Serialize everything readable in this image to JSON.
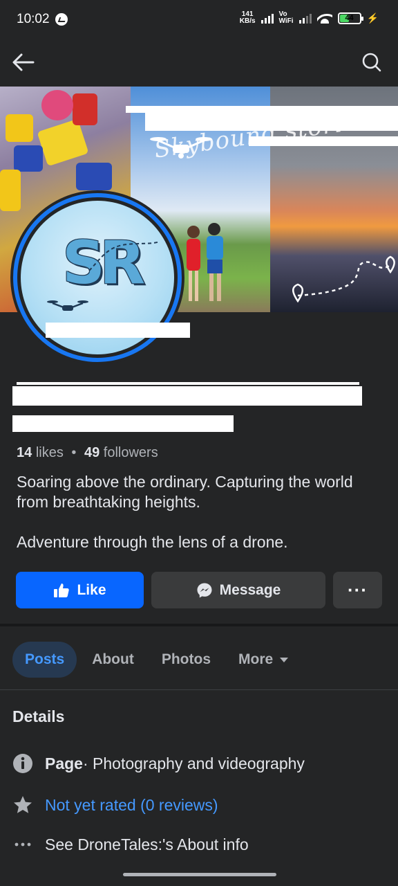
{
  "status_bar": {
    "time": "10:02",
    "net_speed_value": "141",
    "net_speed_unit": "KB/s",
    "vowifi_top": "Vo",
    "vowifi_bottom": "WiFi",
    "battery": "44"
  },
  "nav": {
    "back_icon": "arrow-left-icon",
    "search_icon": "search-icon"
  },
  "cover": {
    "overlay_text": "Skybound stories"
  },
  "avatar": {
    "letters": "SR"
  },
  "stats": {
    "likes_count": "14",
    "likes_label": "likes",
    "separator": "•",
    "followers_count": "49",
    "followers_label": "followers"
  },
  "bio": {
    "line_1": "Soaring above the ordinary. Capturing the world from breathtaking heights.",
    "line_2": "Adventure through the lens of a drone."
  },
  "actions": {
    "like_label": "Like",
    "message_label": "Message",
    "more_label": "···"
  },
  "tabs": [
    {
      "label": "Posts",
      "active": true
    },
    {
      "label": "About",
      "active": false
    },
    {
      "label": "Photos",
      "active": false
    },
    {
      "label": "More",
      "active": false
    }
  ],
  "details": {
    "title": "Details",
    "page_label": "Page",
    "page_category": " · Photography and videography",
    "rating": "Not yet rated (0 reviews)",
    "about_info": "See DroneTales:'s About info"
  },
  "colors": {
    "background": "#242526",
    "accent": "#0866ff",
    "link": "#4599ff",
    "secondary_button": "#3a3b3c"
  }
}
